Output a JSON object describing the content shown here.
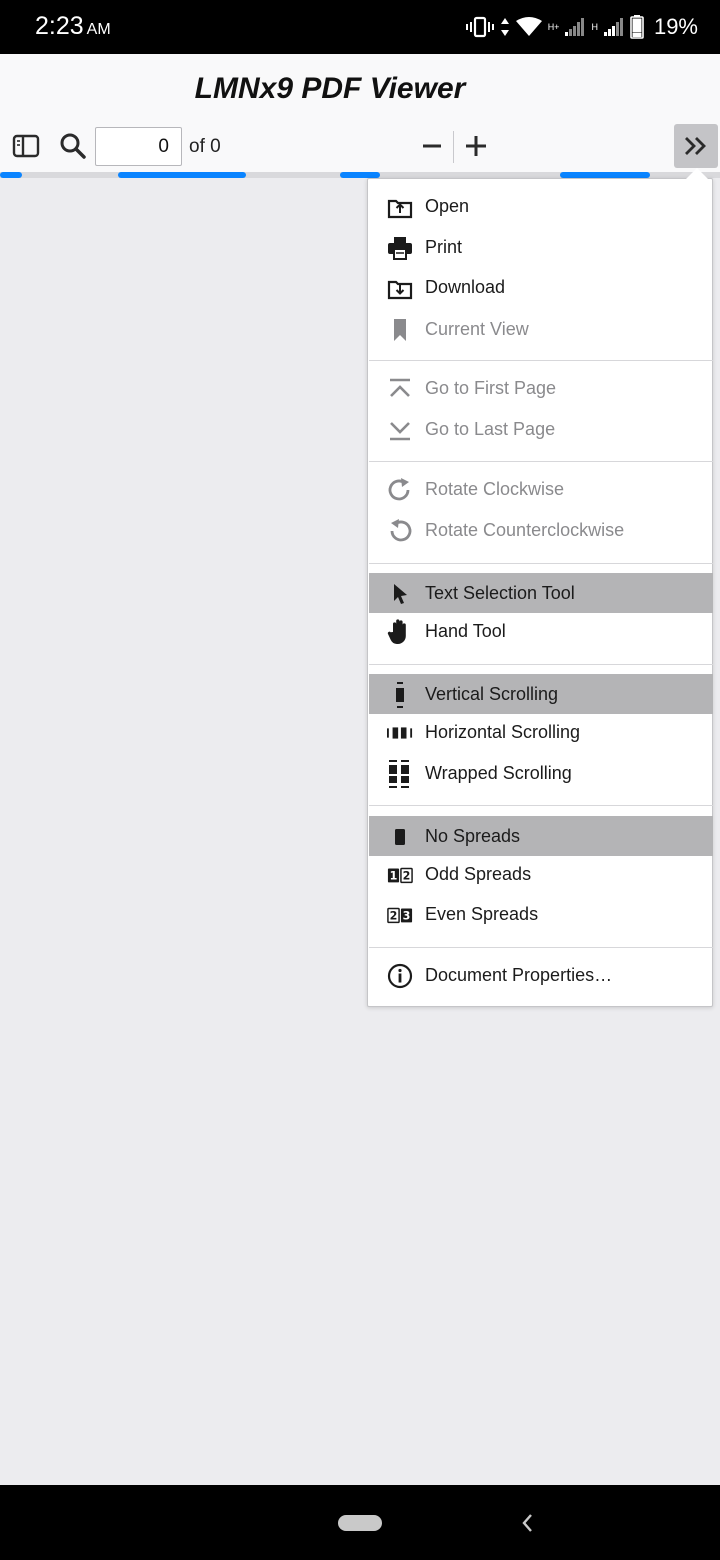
{
  "status_bar": {
    "time": "2:23",
    "ampm": "AM",
    "network_label_1": "H+",
    "network_label_2": "H",
    "battery": "19%"
  },
  "header": {
    "title": "LMNx9 PDF Viewer"
  },
  "toolbar": {
    "page_value": "0",
    "page_count": "of 0"
  },
  "menu": {
    "items": [
      {
        "label": "Open",
        "icon": "open-folder-icon",
        "disabled": false,
        "selected": false
      },
      {
        "label": "Print",
        "icon": "printer-icon",
        "disabled": false,
        "selected": false
      },
      {
        "label": "Download",
        "icon": "download-icon",
        "disabled": false,
        "selected": false
      },
      {
        "label": "Current View",
        "icon": "bookmark-icon",
        "disabled": true,
        "selected": false
      },
      {
        "label": "Go to First Page",
        "icon": "first-page-icon",
        "disabled": true,
        "selected": false
      },
      {
        "label": "Go to Last Page",
        "icon": "last-page-icon",
        "disabled": true,
        "selected": false
      },
      {
        "label": "Rotate Clockwise",
        "icon": "rotate-cw-icon",
        "disabled": true,
        "selected": false
      },
      {
        "label": "Rotate Counterclockwise",
        "icon": "rotate-ccw-icon",
        "disabled": true,
        "selected": false
      },
      {
        "label": "Text Selection Tool",
        "icon": "cursor-icon",
        "disabled": false,
        "selected": true
      },
      {
        "label": "Hand Tool",
        "icon": "hand-icon",
        "disabled": false,
        "selected": false
      },
      {
        "label": "Vertical Scrolling",
        "icon": "vertical-scroll-icon",
        "disabled": false,
        "selected": true
      },
      {
        "label": "Horizontal Scrolling",
        "icon": "horizontal-scroll-icon",
        "disabled": false,
        "selected": false
      },
      {
        "label": "Wrapped Scrolling",
        "icon": "wrapped-scroll-icon",
        "disabled": false,
        "selected": false
      },
      {
        "label": "No Spreads",
        "icon": "no-spreads-icon",
        "disabled": false,
        "selected": true
      },
      {
        "label": "Odd Spreads",
        "icon": "odd-spreads-icon",
        "disabled": false,
        "selected": false
      },
      {
        "label": "Even Spreads",
        "icon": "even-spreads-icon",
        "disabled": false,
        "selected": false
      },
      {
        "label": "Document Properties…",
        "icon": "info-icon",
        "disabled": false,
        "selected": false
      }
    ]
  },
  "colors": {
    "accent": "#0a84ff",
    "selected_bg": "#b4b4b6",
    "disabled_text": "#8a8a8d"
  }
}
